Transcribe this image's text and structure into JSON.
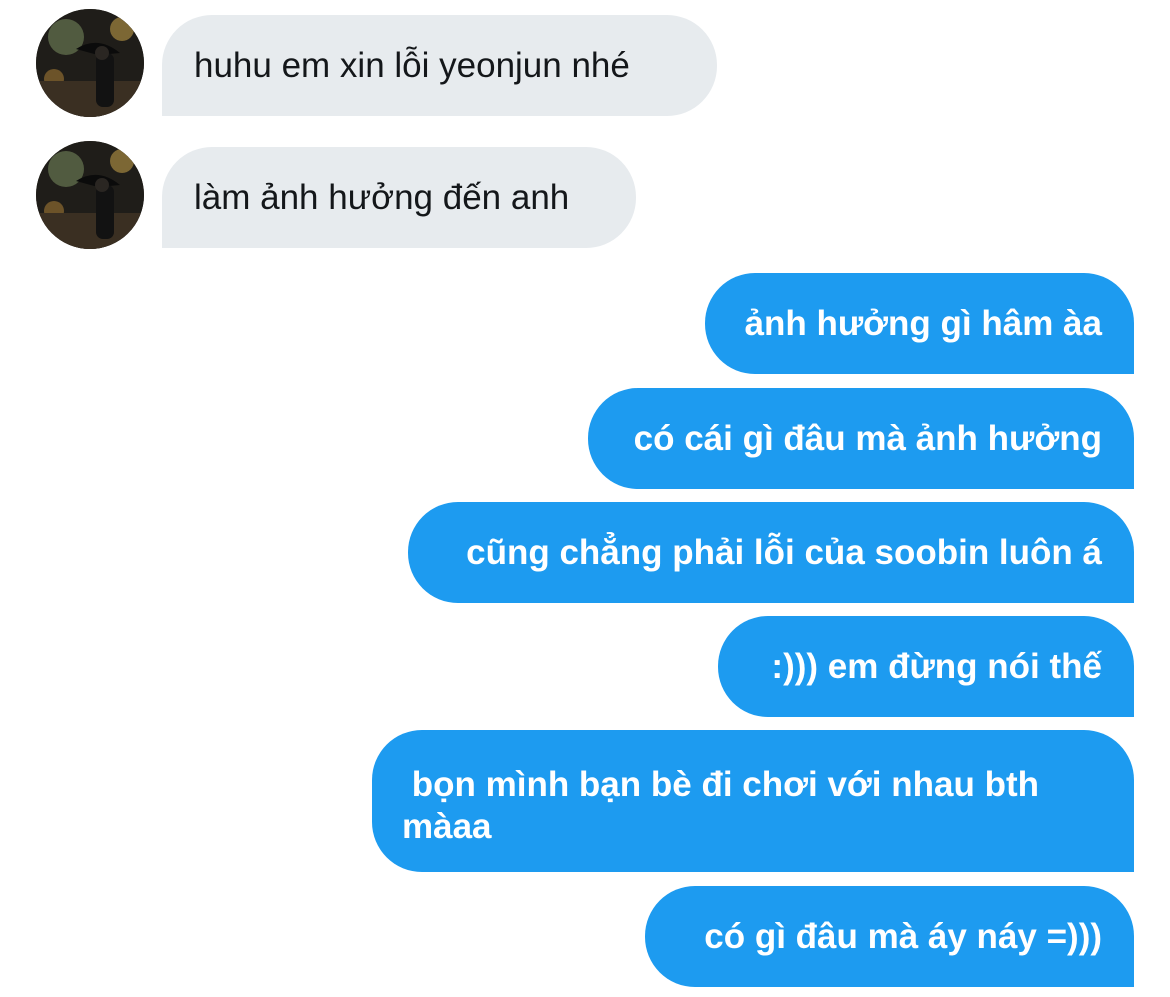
{
  "conversation": {
    "incoming": [
      {
        "text": "huhu em xin lỗi yeonjun nhé"
      },
      {
        "text": "làm ảnh hưởng đến anh"
      }
    ],
    "outgoing": [
      {
        "text": "ảnh hưởng gì hâm àa"
      },
      {
        "text": "có cái gì đâu mà ảnh hưởng"
      },
      {
        "text": "cũng chẳng phải lỗi của soobin luôn á"
      },
      {
        "text": ":))) em đừng nói thế"
      },
      {
        "text": " bọn mình bạn bè đi chơi với nhau bth màaa"
      },
      {
        "text": "có gì đâu mà áy náy =)))"
      }
    ]
  },
  "colors": {
    "incoming_bubble": "#e7ebee",
    "outgoing_bubble": "#1d9bf0",
    "incoming_text": "#14171a",
    "outgoing_text": "#ffffff"
  }
}
